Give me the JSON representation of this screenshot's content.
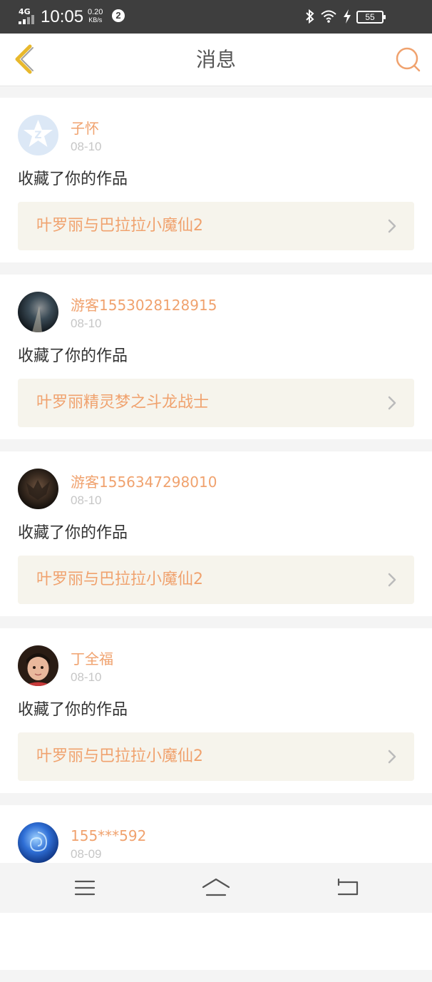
{
  "status_bar": {
    "network": "4G",
    "time": "10:05",
    "speed_value": "0.20",
    "speed_unit": "KB/s",
    "notification_count": "2",
    "battery": "55",
    "icons": [
      "signal-icon",
      "bluetooth-icon",
      "wifi-icon",
      "charging-icon",
      "battery-icon"
    ]
  },
  "header": {
    "title": "消息",
    "back_icon": "chevron-left-icon",
    "search_icon": "search-icon",
    "accent_color": "#f0a26e",
    "back_color": "#e8b82c"
  },
  "messages": [
    {
      "username": "子怀",
      "date": "08-10",
      "action": "收藏了你的作品",
      "work_title": "叶罗丽与巴拉拉小魔仙2",
      "avatar": "default-star-avatar"
    },
    {
      "username": "游客1553028128915",
      "date": "08-10",
      "action": "收藏了你的作品",
      "work_title": "叶罗丽精灵梦之斗龙战士",
      "avatar": "night-sky-avatar"
    },
    {
      "username": "游客1556347298010",
      "date": "08-10",
      "action": "收藏了你的作品",
      "work_title": "叶罗丽与巴拉拉小魔仙2",
      "avatar": "dark-creature-avatar"
    },
    {
      "username": "丁全福",
      "date": "08-10",
      "action": "收藏了你的作品",
      "work_title": "叶罗丽与巴拉拉小魔仙2",
      "avatar": "child-photo-avatar"
    },
    {
      "username": "155***592",
      "date": "08-09",
      "action": "",
      "work_title": "",
      "avatar": "blue-rose-avatar"
    }
  ],
  "nav_bar": {
    "icons": [
      "menu-icon",
      "home-icon",
      "back-icon"
    ]
  }
}
